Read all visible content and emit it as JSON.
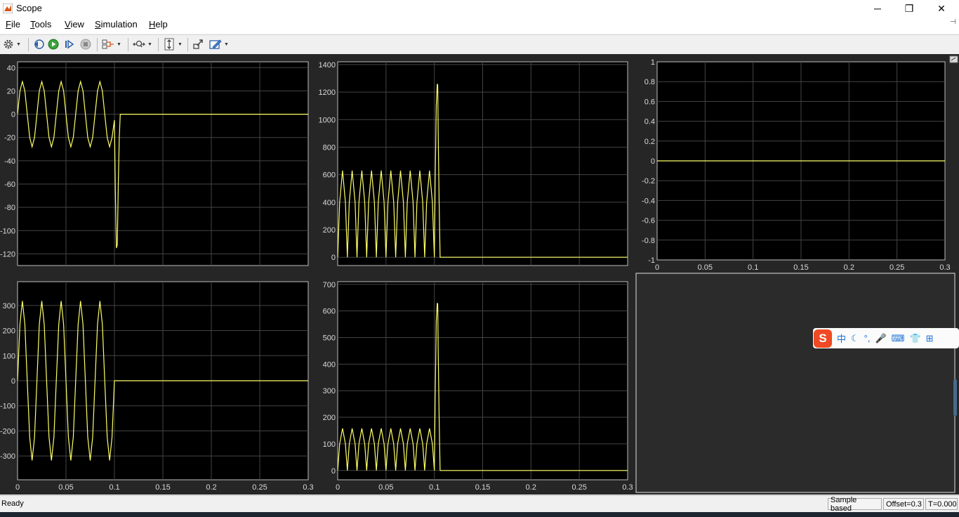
{
  "window": {
    "title": "Scope",
    "minimize_glyph": "─",
    "maximize_glyph": "❐",
    "close_glyph": "✕"
  },
  "menu": {
    "items": [
      {
        "accel": "F",
        "rest": "ile"
      },
      {
        "accel": "T",
        "rest": "ools"
      },
      {
        "accel": "V",
        "rest": "iew"
      },
      {
        "accel": "S",
        "rest": "imulation"
      },
      {
        "accel": "H",
        "rest": "elp"
      }
    ],
    "pin_glyph": "⊣"
  },
  "toolbar": {
    "icons": [
      "gear-icon",
      "step-back-icon",
      "run-icon",
      "step-forward-icon",
      "stop-icon",
      "signal-selector-icon",
      "zoom-icon",
      "scale-axes-icon",
      "highlight-block-icon",
      "style-icon"
    ],
    "dropdown_glyph": "▼"
  },
  "colors": {
    "signal": "#ffff66",
    "grid": "#444444",
    "axes_bg": "#000000",
    "fig_bg": "#262626",
    "tick_text": "#d8d8d8"
  },
  "chart_data": [
    {
      "type": "line",
      "position": "top-left",
      "x": [
        0,
        0.0025,
        0.005,
        0.0075,
        0.01,
        0.0125,
        0.015,
        0.0175,
        0.02,
        0.0225,
        0.025,
        0.0275,
        0.03,
        0.0325,
        0.035,
        0.0375,
        0.04,
        0.0425,
        0.045,
        0.0475,
        0.05,
        0.0525,
        0.055,
        0.0575,
        0.06,
        0.0625,
        0.065,
        0.0675,
        0.07,
        0.0725,
        0.075,
        0.0775,
        0.08,
        0.0825,
        0.085,
        0.0875,
        0.09,
        0.0925,
        0.095,
        0.0975,
        0.1,
        0.101,
        0.102,
        0.103,
        0.104,
        0.105,
        0.106,
        0.3
      ],
      "y": [
        0,
        20,
        28,
        20,
        0,
        -20,
        -28,
        -20,
        0,
        20,
        28,
        20,
        0,
        -20,
        -28,
        -20,
        0,
        20,
        28,
        20,
        0,
        -20,
        -28,
        -20,
        0,
        20,
        28,
        20,
        0,
        -20,
        -28,
        -20,
        0,
        20,
        28,
        20,
        0,
        -20,
        -28,
        -20,
        -5,
        -70,
        -115,
        -112,
        -60,
        -20,
        0,
        0
      ],
      "xlim": [
        0,
        0.3
      ],
      "ylim": [
        -130,
        45
      ],
      "xticks": [],
      "yticks": [
        40,
        20,
        0,
        -20,
        -40,
        -60,
        -80,
        -100,
        -120
      ],
      "grid": true
    },
    {
      "type": "line",
      "position": "top-middle",
      "x": [
        0,
        0.002,
        0.005,
        0.008,
        0.01,
        0.012,
        0.015,
        0.018,
        0.02,
        0.022,
        0.025,
        0.028,
        0.03,
        0.032,
        0.035,
        0.038,
        0.04,
        0.042,
        0.045,
        0.048,
        0.05,
        0.052,
        0.055,
        0.058,
        0.06,
        0.062,
        0.065,
        0.068,
        0.07,
        0.072,
        0.075,
        0.078,
        0.08,
        0.082,
        0.085,
        0.088,
        0.09,
        0.092,
        0.095,
        0.098,
        0.1,
        0.101,
        0.102,
        0.103,
        0.1035,
        0.104,
        0.105,
        0.106,
        0.3
      ],
      "y": [
        0,
        400,
        630,
        400,
        0,
        400,
        630,
        400,
        0,
        400,
        630,
        400,
        0,
        400,
        630,
        400,
        0,
        400,
        630,
        400,
        0,
        400,
        630,
        400,
        0,
        400,
        630,
        400,
        0,
        400,
        630,
        400,
        0,
        400,
        630,
        400,
        0,
        400,
        630,
        400,
        0,
        600,
        1100,
        1260,
        1250,
        900,
        400,
        0,
        0
      ],
      "xlim": [
        0,
        0.3
      ],
      "ylim": [
        -60,
        1420
      ],
      "xticks": [],
      "yticks": [
        1400,
        1200,
        1000,
        800,
        600,
        400,
        200,
        0
      ],
      "grid": true
    },
    {
      "type": "line",
      "position": "top-right",
      "x": [
        0,
        0.3
      ],
      "y": [
        0,
        0
      ],
      "xlim": [
        0,
        0.3
      ],
      "ylim": [
        -1,
        1
      ],
      "xticks": [
        "0",
        "0.05",
        "0.1",
        "0.15",
        "0.2",
        "0.25",
        "0.3"
      ],
      "yticks": [
        "1",
        "0.8",
        "0.6",
        "0.4",
        "0.2",
        "0",
        "-0.2",
        "-0.4",
        "-0.6",
        "-0.8",
        "-1"
      ],
      "grid": true
    },
    {
      "type": "line",
      "position": "bottom-left",
      "x": [
        0,
        0.0025,
        0.005,
        0.0075,
        0.01,
        0.0125,
        0.015,
        0.0175,
        0.02,
        0.0225,
        0.025,
        0.0275,
        0.03,
        0.0325,
        0.035,
        0.0375,
        0.04,
        0.0425,
        0.045,
        0.0475,
        0.05,
        0.0525,
        0.055,
        0.0575,
        0.06,
        0.0625,
        0.065,
        0.0675,
        0.07,
        0.0725,
        0.075,
        0.0775,
        0.08,
        0.0825,
        0.085,
        0.0875,
        0.09,
        0.0925,
        0.095,
        0.0975,
        0.1,
        0.3
      ],
      "y": [
        0,
        225,
        318,
        225,
        0,
        -225,
        -318,
        -225,
        0,
        225,
        318,
        225,
        0,
        -225,
        -318,
        -225,
        0,
        225,
        318,
        225,
        0,
        -225,
        -318,
        -225,
        0,
        225,
        318,
        225,
        0,
        -225,
        -318,
        -225,
        0,
        225,
        318,
        225,
        0,
        -225,
        -318,
        -225,
        0,
        0
      ],
      "xlim": [
        0,
        0.3
      ],
      "ylim": [
        -395,
        395
      ],
      "xticks": [
        "0",
        "0.05",
        "0.1",
        "0.15",
        "0.2",
        "0.25",
        "0.3"
      ],
      "yticks": [
        "300",
        "200",
        "100",
        "0",
        "-100",
        "-200",
        "-300"
      ],
      "grid": true
    },
    {
      "type": "line",
      "position": "bottom-middle",
      "x": [
        0,
        0.002,
        0.005,
        0.008,
        0.01,
        0.012,
        0.015,
        0.018,
        0.02,
        0.022,
        0.025,
        0.028,
        0.03,
        0.032,
        0.035,
        0.038,
        0.04,
        0.042,
        0.045,
        0.048,
        0.05,
        0.052,
        0.055,
        0.058,
        0.06,
        0.062,
        0.065,
        0.068,
        0.07,
        0.072,
        0.075,
        0.078,
        0.08,
        0.082,
        0.085,
        0.088,
        0.09,
        0.092,
        0.095,
        0.098,
        0.1,
        0.101,
        0.102,
        0.103,
        0.1035,
        0.104,
        0.105,
        0.106,
        0.3
      ],
      "y": [
        0,
        100,
        158,
        100,
        0,
        100,
        158,
        100,
        0,
        100,
        158,
        100,
        0,
        100,
        158,
        100,
        0,
        100,
        158,
        100,
        0,
        100,
        158,
        100,
        0,
        100,
        158,
        100,
        0,
        100,
        158,
        100,
        0,
        100,
        158,
        100,
        0,
        100,
        158,
        100,
        0,
        300,
        560,
        630,
        625,
        450,
        200,
        0,
        0
      ],
      "xlim": [
        0,
        0.3
      ],
      "ylim": [
        -35,
        710
      ],
      "xticks": [
        "0",
        "0.05",
        "0.1",
        "0.15",
        "0.2",
        "0.25",
        "0.3"
      ],
      "yticks": [
        "700",
        "600",
        "500",
        "400",
        "300",
        "200",
        "100",
        "0"
      ],
      "grid": true
    }
  ],
  "status": {
    "left": "Ready",
    "mode": "Sample based",
    "offset": "Offset=0.3",
    "time": "T=0.000"
  },
  "ime": {
    "lang": "中",
    "moon": "☾",
    "punct": "°,",
    "mic": "🎤",
    "kbd": "⌨",
    "shirt": "👕",
    "grid": "⊞",
    "logo": "S"
  }
}
